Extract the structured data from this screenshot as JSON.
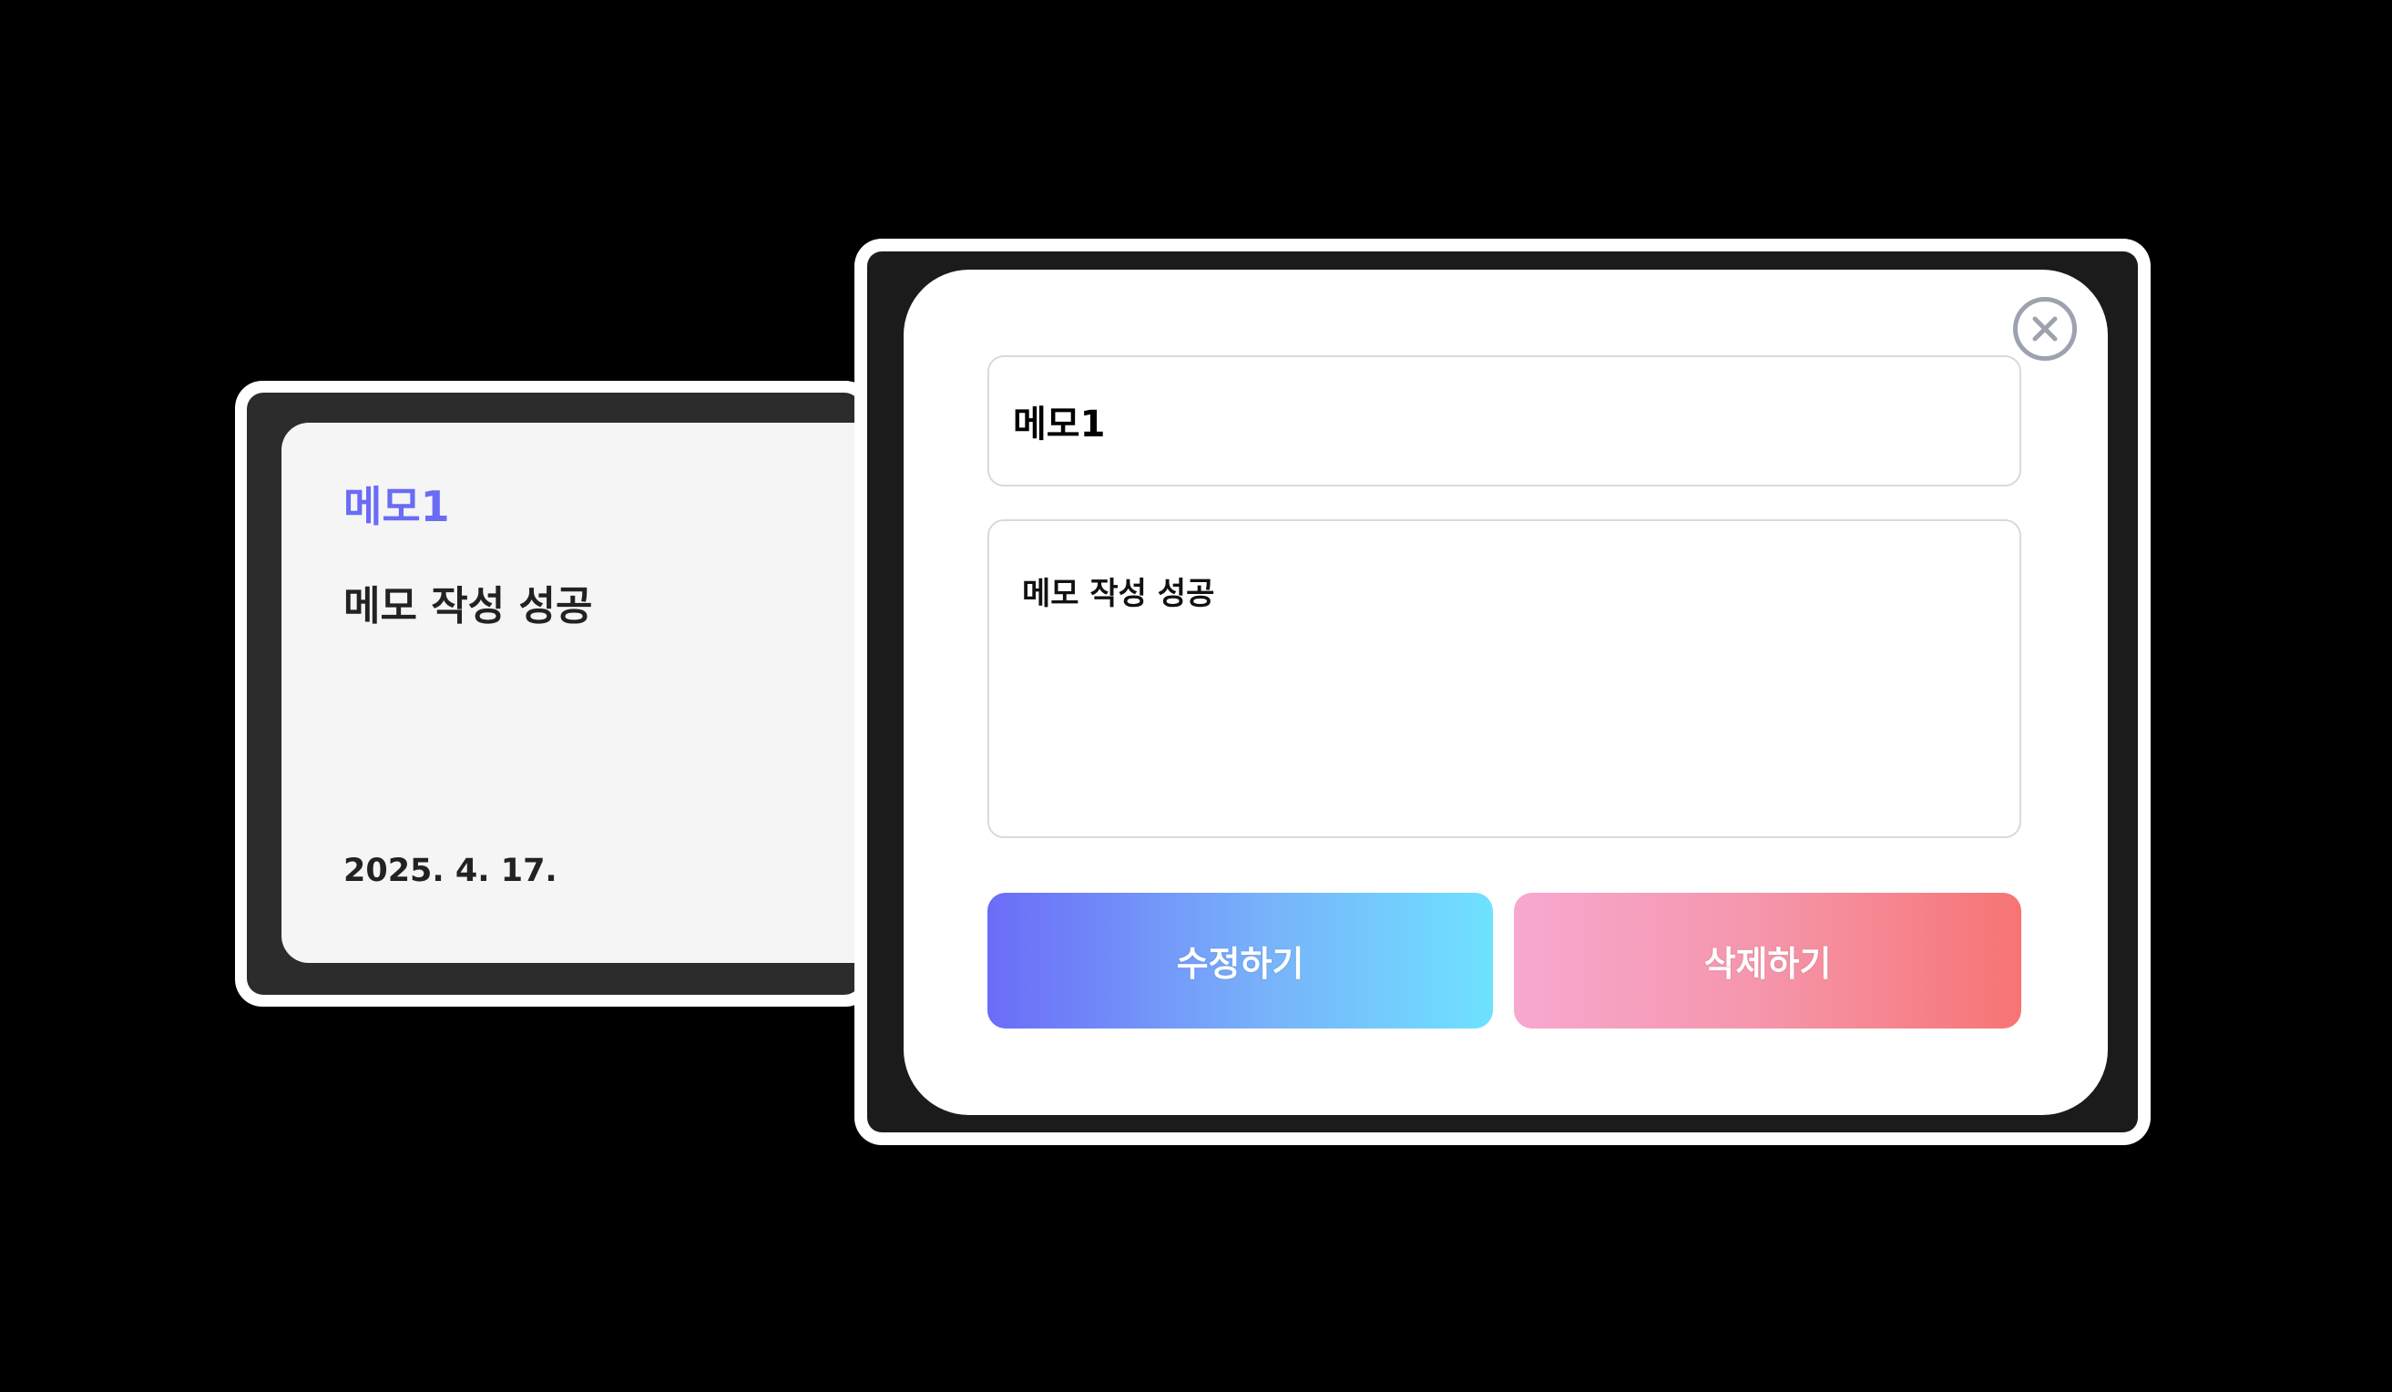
{
  "memo_card": {
    "title": "메모1",
    "content": "메모 작성 성공",
    "date": "2025. 4. 17.",
    "title_color": "#6a6cf6"
  },
  "edit_modal": {
    "title_value": "메모1",
    "content_value": "메모 작성 성공",
    "edit_label": "수정하기",
    "delete_label": "삭제하기",
    "close_icon": "close-circle-icon",
    "edit_gradient": [
      "#6b6cf8",
      "#6ee2ff"
    ],
    "delete_gradient": [
      "#f7a8d0",
      "#f77474"
    ]
  }
}
